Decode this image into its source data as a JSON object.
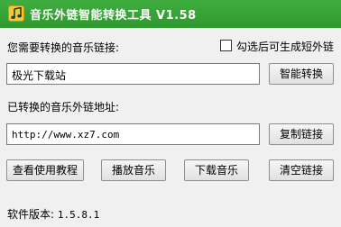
{
  "window": {
    "title": "音乐外链智能转换工具 V1.58",
    "icon": "music-note-icon"
  },
  "source": {
    "label": "您需要转换的音乐链接:",
    "value": "极光下载站",
    "convert_button": "智能转换",
    "short_link_checkbox": {
      "label": "勾选后可生成短外链",
      "checked": false
    }
  },
  "result": {
    "label": "已转换的音乐外链地址:",
    "value": "http://www.xz7.com",
    "copy_button": "复制链接"
  },
  "actions": {
    "tutorial": "查看使用教程",
    "play": "播放音乐",
    "download": "下载音乐",
    "clear": "清空链接"
  },
  "status": {
    "label": "软件版本:",
    "version": "1.5.8.1"
  }
}
